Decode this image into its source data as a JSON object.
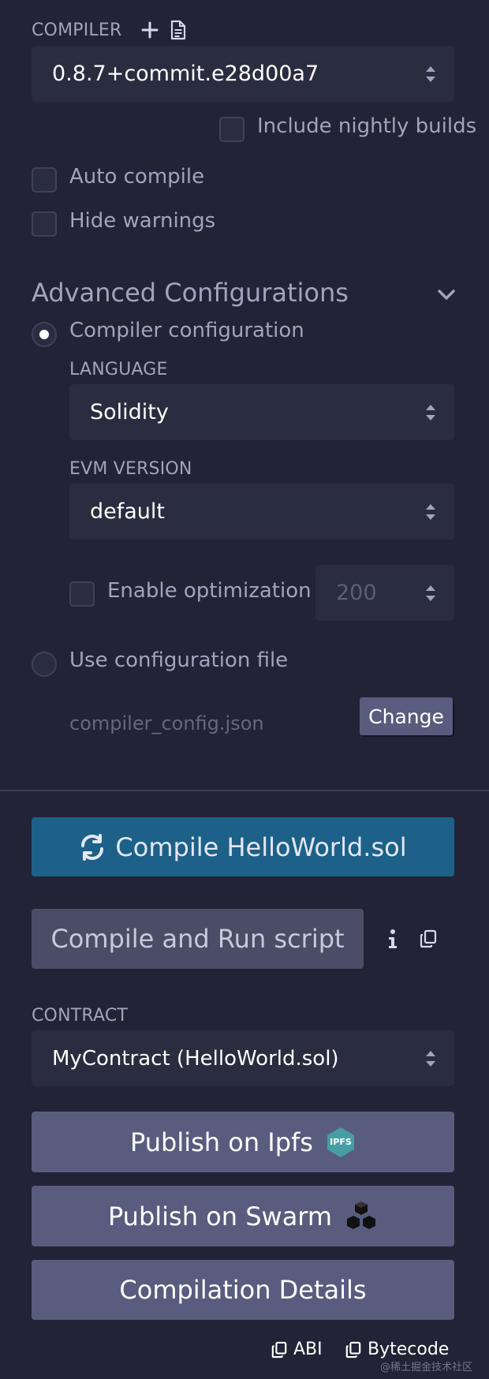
{
  "compiler": {
    "label": "COMPILER",
    "add_icon": "plus-icon",
    "file_icon": "file-text-icon",
    "version": "0.8.7+commit.e28d00a7",
    "include_nightly": "Include nightly builds",
    "auto_compile": "Auto compile",
    "hide_warnings": "Hide warnings"
  },
  "advanced": {
    "title": "Advanced Configurations",
    "chevron_icon": "chevron-down-icon",
    "compiler_configuration": "Compiler configuration",
    "language_label": "LANGUAGE",
    "language_value": "Solidity",
    "evm_label": "EVM VERSION",
    "evm_value": "default",
    "enable_optimization": "Enable optimization",
    "runs_placeholder": "200",
    "use_config_file": "Use configuration file",
    "config_file_name": "compiler_config.json",
    "change_label": "Change"
  },
  "actions": {
    "compile_icon": "refresh-icon",
    "compile_label": "Compile HelloWorld.sol",
    "compile_run_label": "Compile and Run script",
    "info_icon": "info-icon",
    "copy_icon": "copy-icon"
  },
  "contract": {
    "label": "CONTRACT",
    "value": "MyContract (HelloWorld.sol)"
  },
  "publish": {
    "ipfs_label": "Publish on Ipfs",
    "ipfs_badge": "IPFS",
    "swarm_label": "Publish on Swarm",
    "swarm_icon": "swarm-cubes-icon",
    "details_label": "Compilation Details"
  },
  "footer": {
    "abi_label": "ABI",
    "bytecode_label": "Bytecode",
    "watermark": "@稀土掘金技术社区"
  },
  "colors": {
    "background": "#222336",
    "panel": "#2a2c3f",
    "primary": "#1d6188",
    "secondary": "#4b4d66",
    "publish": "#595c7e",
    "ipfs": "#469ea2"
  }
}
